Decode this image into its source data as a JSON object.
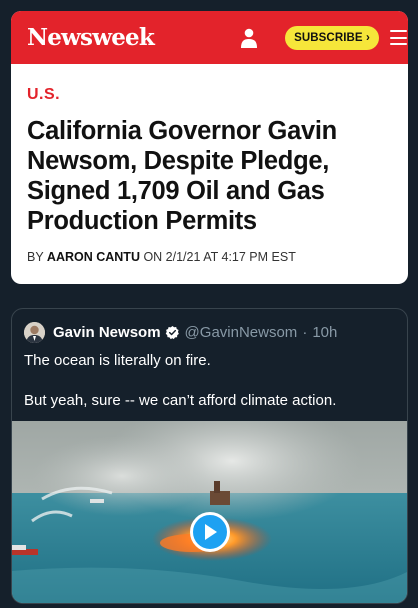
{
  "newsweek": {
    "logo": "Newsweek",
    "subscribe_label": "SUBSCRIBE ›",
    "section": "U.S.",
    "headline": "California Governor Gavin Newsom, Despite Pledge, Signed 1,709 Oil and Gas Production Permits",
    "byline_prefix": "BY ",
    "author": "AARON CANTU",
    "byline_date": " ON 2/1/21 AT 4:17 PM EST",
    "icons": [
      "user-icon",
      "menu-icon"
    ],
    "colors": {
      "brand_red": "#e3232b",
      "subscribe_yellow": "#f6e63a"
    }
  },
  "tweet": {
    "name": "Gavin Newsom",
    "handle": "@GavinNewsom",
    "separator": "·",
    "time": "10h",
    "text_line1": "The ocean is literally on fire.",
    "text_line2": "But yeah, sure -- we can’t afford climate action.",
    "icons": [
      "verified-badge-icon",
      "play-icon"
    ],
    "colors": {
      "background": "#15202b",
      "accent": "#1da1f2",
      "muted": "#8899a6"
    }
  }
}
